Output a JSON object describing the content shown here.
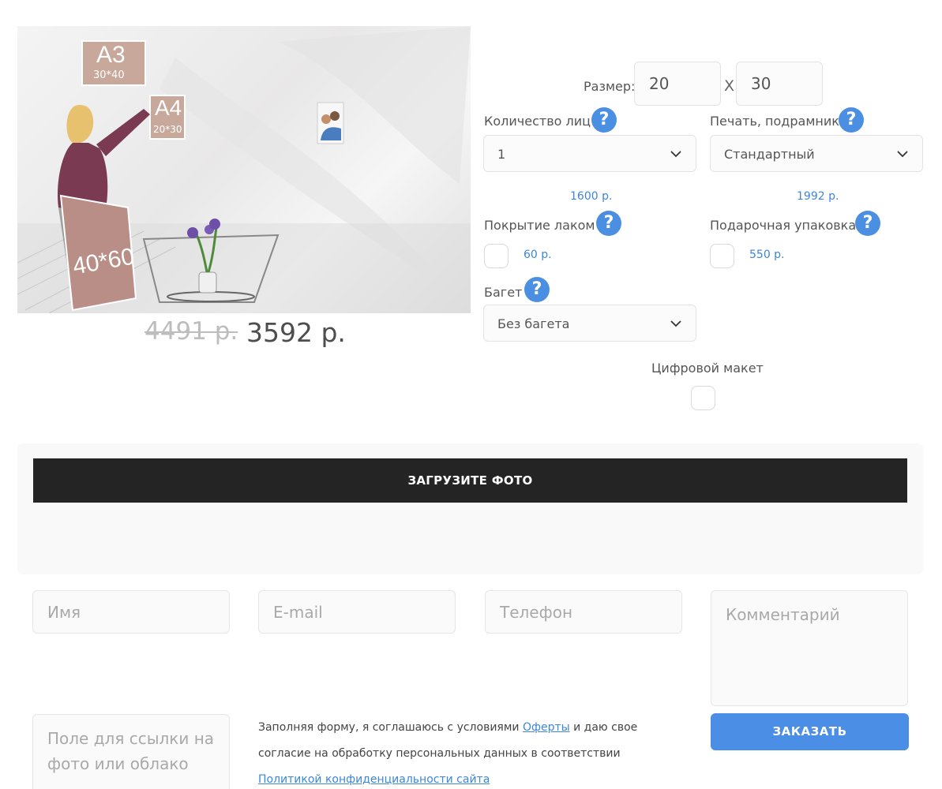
{
  "product": {
    "image_labels": {
      "a3": "A3",
      "a3_size": "30*40",
      "a4": "A4",
      "a4_size": "20*30",
      "big_size": "40*60"
    },
    "price_old": "4491 р.",
    "price_new": "3592 р."
  },
  "options": {
    "size_label": "Размер:",
    "size_width": "20",
    "size_separator": "X",
    "size_height": "30",
    "faces": {
      "label": "Количество лиц",
      "value": "1",
      "price": "1600 р."
    },
    "print": {
      "label": "Печать, подрамник",
      "value": "Стандартный",
      "price": "1992 р."
    },
    "varnish": {
      "label": "Покрытие лаком",
      "price": "60 р."
    },
    "gift_wrap": {
      "label": "Подарочная упаковка",
      "price": "550 р."
    },
    "baguette": {
      "label": "Багет",
      "value": "Без багета"
    },
    "digital": {
      "label": "Цифровой макет"
    },
    "help_symbol": "?"
  },
  "upload": {
    "label": "ЗАГРУЗИТЕ ФОТО"
  },
  "form": {
    "name_placeholder": "Имя",
    "email_placeholder": "E-mail",
    "phone_placeholder": "Телефон",
    "comment_placeholder": "Комментарий",
    "link_placeholder": "Поле для ссылки на фото или облако",
    "consent_text_1": "Заполняя форму, я соглашаюсь с условиями",
    "consent_link_1": "Оферты",
    "consent_text_2": "и даю свое согласие на обработку персональных данных в соответствии",
    "consent_link_2": "Политикой конфиденциальности сайта",
    "submit_label": "ЗАКАЗАТЬ"
  },
  "colors": {
    "accent": "#4a8fe5",
    "dark_button": "#242424",
    "price_link": "#3d86d8"
  }
}
